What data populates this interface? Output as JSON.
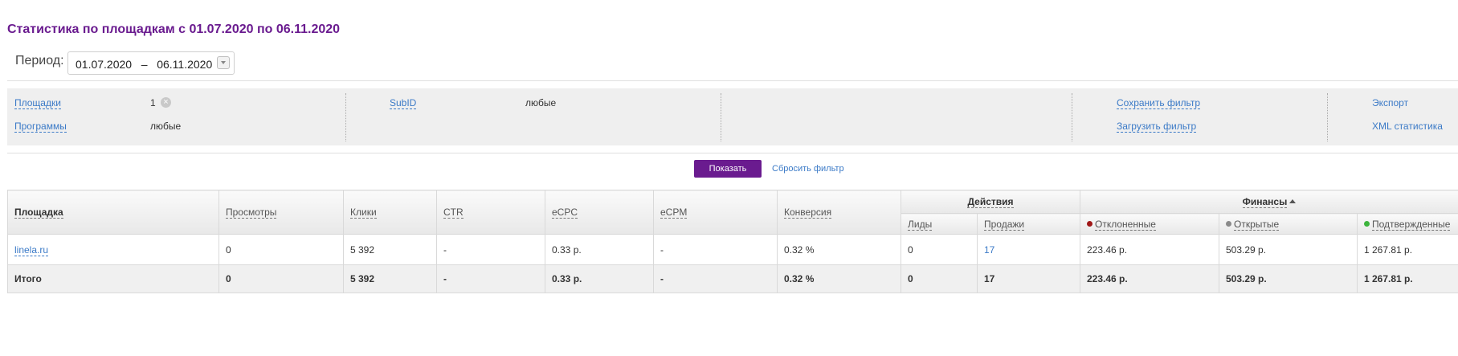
{
  "page_title": "Статистика по площадкам с 01.07.2020 по 06.11.2020",
  "period": {
    "label": "Период:",
    "from": "01.07.2020",
    "separator": "–",
    "to": "06.11.2020"
  },
  "filters": {
    "platforms": {
      "label": "Площадки",
      "value": "1"
    },
    "programs": {
      "label": "Программы",
      "value": "любые"
    },
    "subid": {
      "label": "SubID",
      "value": "любые"
    },
    "save_filter": "Сохранить фильтр",
    "load_filter": "Загрузить фильтр",
    "export": "Экспорт",
    "xml_stats": "XML статистика"
  },
  "actions": {
    "show_label": "Показать",
    "reset_label": "Сбросить фильтр"
  },
  "table": {
    "columns": {
      "platform": "Площадка",
      "views": "Просмотры",
      "clicks": "Клики",
      "ctr": "CTR",
      "ecpc": "eCPC",
      "ecpm": "eCPM",
      "conversion": "Конверсия",
      "actions_group": "Действия",
      "leads": "Лиды",
      "sales": "Продажи",
      "finance_group": "Финансы",
      "rejected": "Отклоненные",
      "open": "Открытые",
      "confirmed": "Подтвержденные"
    },
    "status_colors": {
      "rejected": "#a01818",
      "open": "#8a8a8a",
      "confirmed": "#3cb43c"
    },
    "rows": [
      {
        "platform": "linela.ru",
        "views": "0",
        "clicks": "5 392",
        "ctr": "-",
        "ecpc": "0.33 р.",
        "ecpm": "-",
        "conversion": "0.32 %",
        "leads": "0",
        "sales": "17",
        "rejected": "223.46 р.",
        "open": "503.29 р.",
        "confirmed": "1 267.81 р."
      }
    ],
    "total": {
      "platform": "Итого",
      "views": "0",
      "clicks": "5 392",
      "ctr": "-",
      "ecpc": "0.33 р.",
      "ecpm": "-",
      "conversion": "0.32 %",
      "leads": "0",
      "sales": "17",
      "rejected": "223.46 р.",
      "open": "503.29 р.",
      "confirmed": "1 267.81 р."
    }
  }
}
